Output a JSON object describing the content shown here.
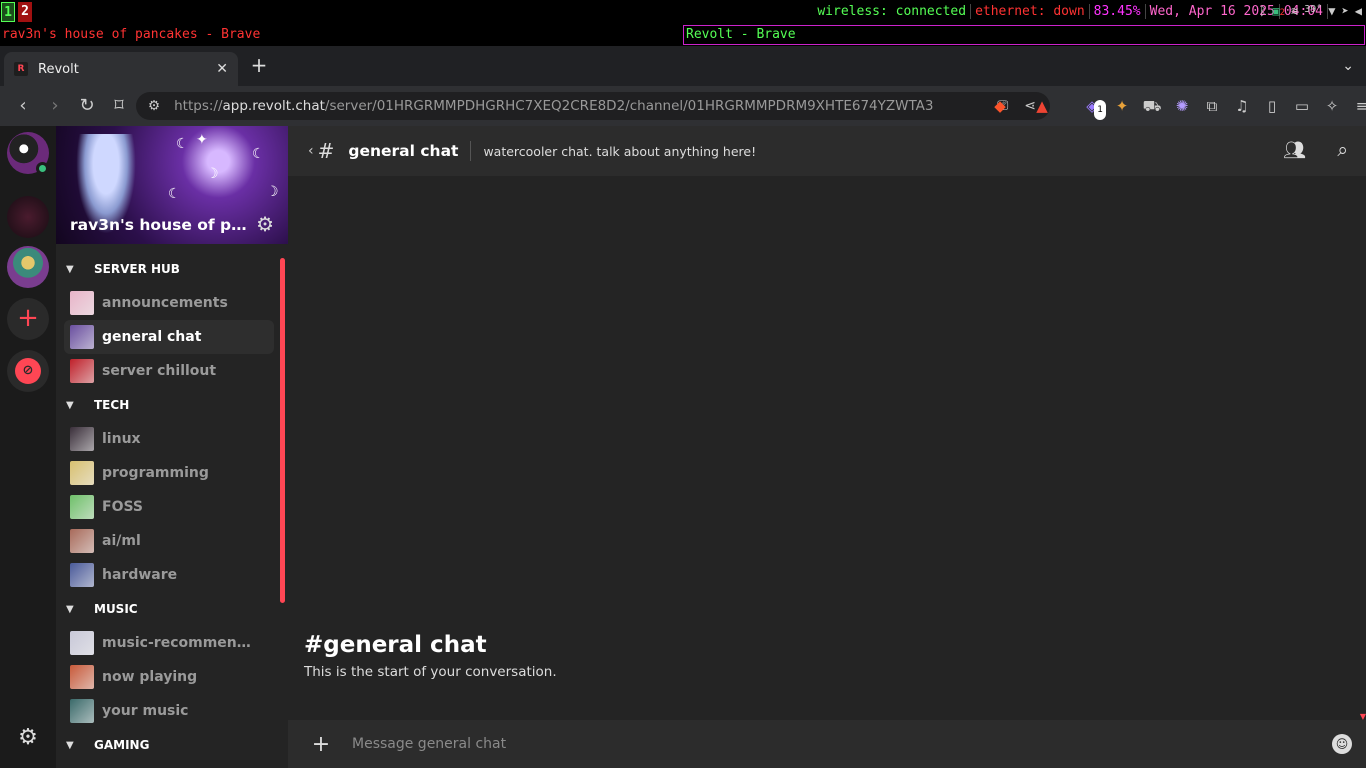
{
  "wm": {
    "workspaces": [
      "1",
      "2"
    ],
    "status": {
      "wireless": "wireless: connected",
      "ethernet": "ethernet: down",
      "battery": "83.45%",
      "date": "Wed, Apr 16 2025",
      "time": "04:04",
      "temp": "39°"
    },
    "tray_badge": "2",
    "window_title_left": "rav3n's house of pancakes - Brave",
    "window_title_right": "Revolt - Brave"
  },
  "browser": {
    "tab_title": "Revolt",
    "tab_favicon": "R",
    "url_scheme": "https://",
    "url_host": "app.revolt.chat",
    "url_path": "/server/01HRGRMMPDHGRHC7XEQ2CRE8D2/channel/01HRGRMMPDRM9XHTE674YZWTA3",
    "ext_badge": "1"
  },
  "server": {
    "name": "rav3n's house of pancakes"
  },
  "categories": [
    {
      "label": "SERVER HUB",
      "channels": [
        {
          "label": "announcements",
          "color": "#e8b4c8"
        },
        {
          "label": "general chat",
          "color": "#6a4fa0",
          "active": true
        },
        {
          "label": "server chillout",
          "color": "#c0202a"
        }
      ]
    },
    {
      "label": "TECH",
      "channels": [
        {
          "label": "linux",
          "color": "#3a2f3a"
        },
        {
          "label": "programming",
          "color": "#d8c070"
        },
        {
          "label": "FOSS",
          "color": "#6fc06a"
        },
        {
          "label": "ai/ml",
          "color": "#a86a5a"
        },
        {
          "label": "hardware",
          "color": "#4a5a9a"
        }
      ]
    },
    {
      "label": "MUSIC",
      "channels": [
        {
          "label": "music-recommendations",
          "color": "#c8c8d8"
        },
        {
          "label": "now playing",
          "color": "#c85a3a"
        },
        {
          "label": "your music",
          "color": "#3a6a6a"
        }
      ]
    },
    {
      "label": "GAMING",
      "channels": []
    }
  ],
  "chat": {
    "channel_name": "general chat",
    "topic": "watercooler chat. talk about anything here!",
    "welcome_title": "#general chat",
    "welcome_sub": "This is the start of your conversation.",
    "input_placeholder": "Message general chat"
  },
  "colors": {
    "accent": "#ff4654",
    "online": "#3abf7e"
  }
}
